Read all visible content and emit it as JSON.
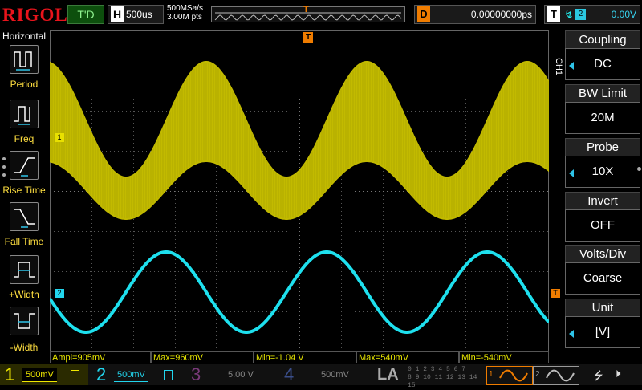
{
  "brand": "RIGOL",
  "run_status": "T'D",
  "timebase": {
    "key": "H",
    "value": "500us"
  },
  "acq": {
    "rate": "500MSa/s",
    "points": "3.00M pts"
  },
  "trigger_pos_marker": "T",
  "delay": {
    "key": "D",
    "value": "0.00000000ps"
  },
  "trigger": {
    "key": "T",
    "edge": "↯",
    "source": "2",
    "level": "0.00V"
  },
  "left_menu": {
    "title": "Horizontal",
    "items": [
      {
        "label": "Period",
        "icon": "period-icon"
      },
      {
        "label": "Freq",
        "icon": "freq-icon"
      },
      {
        "label": "Rise Time",
        "icon": "rise-time-icon"
      },
      {
        "label": "Fall Time",
        "icon": "fall-time-icon"
      },
      {
        "label": "+Width",
        "icon": "positive-width-icon"
      },
      {
        "label": "-Width",
        "icon": "negative-width-icon"
      }
    ]
  },
  "channel_markers": {
    "ch1": "1",
    "ch2": "2",
    "trig_level": "T"
  },
  "measurements": [
    {
      "text": "Ampl=905mV"
    },
    {
      "text": "Max=960mV"
    },
    {
      "text": "Min=-1.04 V"
    },
    {
      "text": "Max=540mV"
    },
    {
      "text": "Min=-540mV"
    }
  ],
  "right_menu": {
    "channel_tag": "CH1",
    "items": [
      {
        "title": "Coupling",
        "value": "DC",
        "has_arrow": true
      },
      {
        "title": "BW Limit",
        "value": "20M",
        "has_arrow": false
      },
      {
        "title": "Probe",
        "value": "10X",
        "has_arrow": true
      },
      {
        "title": "Invert",
        "value": "OFF",
        "has_arrow": false
      },
      {
        "title": "Volts/Div",
        "value": "Coarse",
        "has_arrow": false
      },
      {
        "title": "Unit",
        "value": "[V]",
        "has_arrow": true
      }
    ]
  },
  "bottom": {
    "ch1": {
      "num": "1",
      "scale": "500mV",
      "color": "#f0e800"
    },
    "ch2": {
      "num": "2",
      "scale": "500mV",
      "color": "#22d6ee"
    },
    "ch3": {
      "num": "3",
      "scale": "5.00 V",
      "color": "#c040c0"
    },
    "ch4": {
      "num": "4",
      "scale": "500mV",
      "color": "#4070f0"
    },
    "la": "LA",
    "la_bits": [
      "0 1 2 3  4 5 6 7",
      "8 9 10 11  12 13 14 15"
    ],
    "gen1": "1",
    "gen2": "2"
  },
  "colors": {
    "ch1": "#c8c000",
    "ch2": "#1ee0ee",
    "trigger": "#ef7c00",
    "grid": "#3a3a3a"
  }
}
